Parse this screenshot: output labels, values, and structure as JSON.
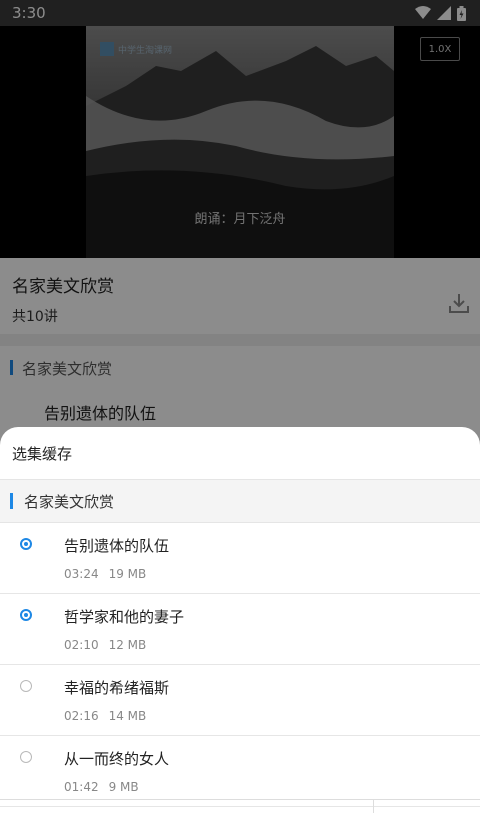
{
  "status": {
    "time": "3:30"
  },
  "video": {
    "watermark": "中学生淘课网",
    "caption": "朗诵：月下泛舟",
    "speed": "1.0X"
  },
  "course": {
    "title": "名家美文欣赏",
    "count": "共10讲"
  },
  "background_section": {
    "label": "名家美文欣赏",
    "first_item": "告别遗体的队伍"
  },
  "sheet": {
    "title": "选集缓存",
    "section_label": "名家美文欣赏",
    "episodes": [
      {
        "name": "告别遗体的队伍",
        "duration": "03:24",
        "size": "19 MB",
        "selected": true
      },
      {
        "name": "哲学家和他的妻子",
        "duration": "02:10",
        "size": "12 MB",
        "selected": true
      },
      {
        "name": "幸福的希绪福斯",
        "duration": "02:16",
        "size": "14 MB",
        "selected": false
      },
      {
        "name": "从一而终的女人",
        "duration": "01:42",
        "size": "9 MB",
        "selected": false
      }
    ]
  },
  "colors": {
    "accent": "#1e88e5"
  }
}
